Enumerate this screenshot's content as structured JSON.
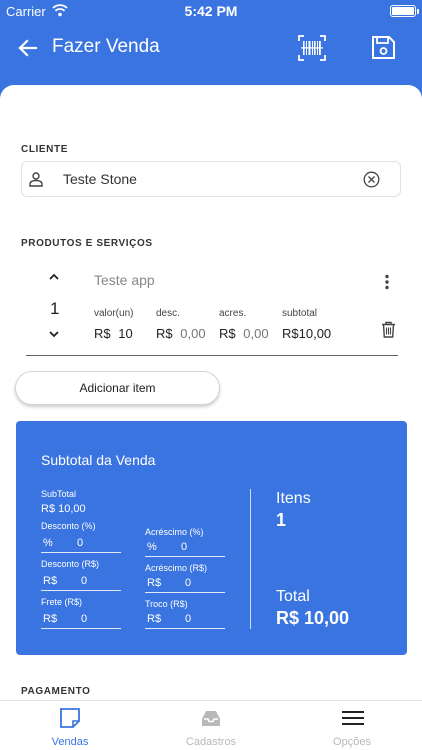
{
  "status_bar": {
    "carrier": "Carrier",
    "time": "5:42 PM"
  },
  "app_bar": {
    "title": "Fazer Venda"
  },
  "client": {
    "section_label": "CLIENTE",
    "name": "Teste Stone"
  },
  "products": {
    "section_label": "PRODUTOS E SERVIÇOS",
    "item": {
      "name": "Teste app",
      "quantity": "1",
      "unit_value_label": "valor(un)",
      "unit_value_currency": "R$",
      "unit_value": "10",
      "discount_label": "desc.",
      "discount_currency": "R$",
      "discount_value": "0,00",
      "surcharge_label": "acres.",
      "surcharge_currency": "R$",
      "surcharge_value": "0,00",
      "subtotal_label": "subtotal",
      "subtotal_value": "R$10,00"
    },
    "add_item_label": "Adicionar item"
  },
  "summary": {
    "title": "Subtotal da Venda",
    "subtotal_label": "SubTotal",
    "subtotal_value": "R$ 10,00",
    "discount_pct_label": "Desconto (%)",
    "discount_pct_prefix": "%",
    "discount_pct_value": "0",
    "surcharge_pct_label": "Acréscimo (%)",
    "surcharge_pct_prefix": "%",
    "surcharge_pct_value": "0",
    "discount_brl_label": "Desconto (R$)",
    "discount_brl_prefix": "R$",
    "discount_brl_value": "0",
    "surcharge_brl_label": "Acréscimo (R$)",
    "surcharge_brl_prefix": "R$",
    "surcharge_brl_value": "0",
    "freight_label": "Frete (R$)",
    "freight_prefix": "R$",
    "freight_value": "0",
    "change_label": "Troco (R$)",
    "change_prefix": "R$",
    "change_value": "0",
    "items_label": "Itens",
    "items_count": "1",
    "total_label": "Total",
    "total_value": "R$ 10,00"
  },
  "payment": {
    "section_label": "PAGAMENTO"
  },
  "tab_bar": {
    "tabs": [
      {
        "label": "Vendas",
        "icon": "sales-icon",
        "active": true
      },
      {
        "label": "Cadastros",
        "icon": "inbox-icon",
        "active": false
      },
      {
        "label": "Opções",
        "icon": "menu-icon",
        "active": false
      }
    ]
  },
  "colors": {
    "primary": "#3a74e0",
    "active_tab": "#3a74e0",
    "inactive_tab": "#b8b8b8",
    "background": "#ffffff"
  }
}
